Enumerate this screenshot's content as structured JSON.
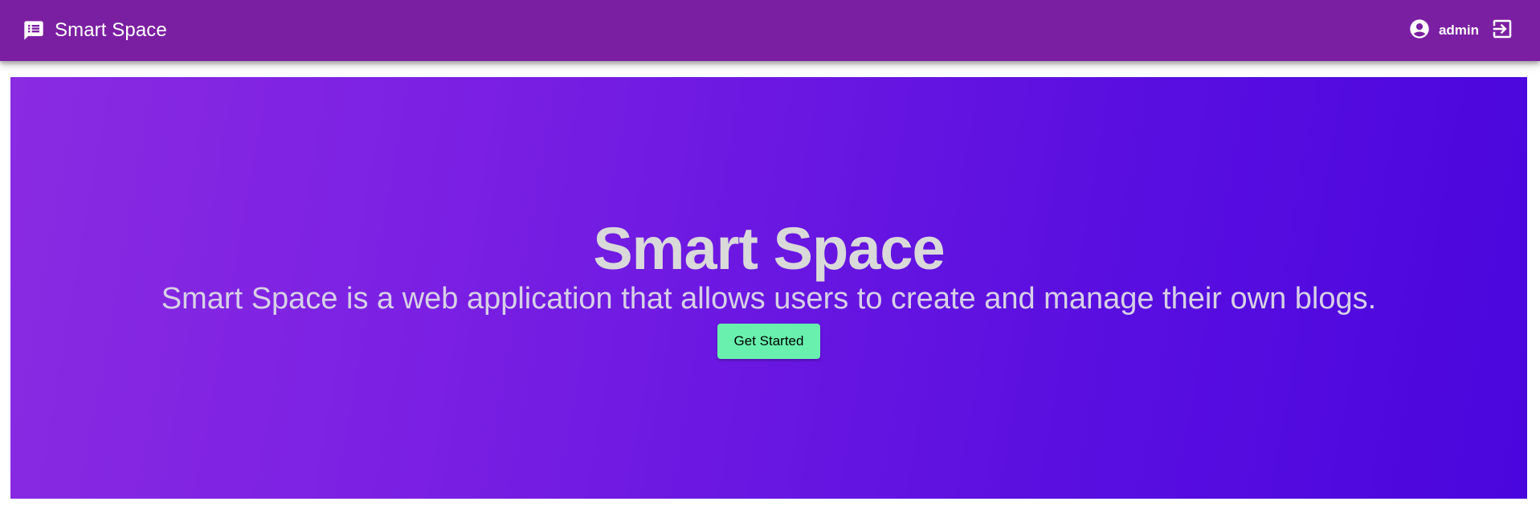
{
  "header": {
    "app_title": "Smart Space",
    "brand_icon": "chat-list-icon",
    "user_icon": "account-circle-icon",
    "username": "admin",
    "logout_icon": "logout-icon",
    "background_color": "#7b1fa2"
  },
  "hero": {
    "title": "Smart Space",
    "subtitle": "Smart Space is a web application that allows users to create and manage their own blogs.",
    "cta_label": "Get Started",
    "cta_color": "#69f0ae",
    "gradient_start": "#8a2be2",
    "gradient_end": "#4a06de"
  }
}
